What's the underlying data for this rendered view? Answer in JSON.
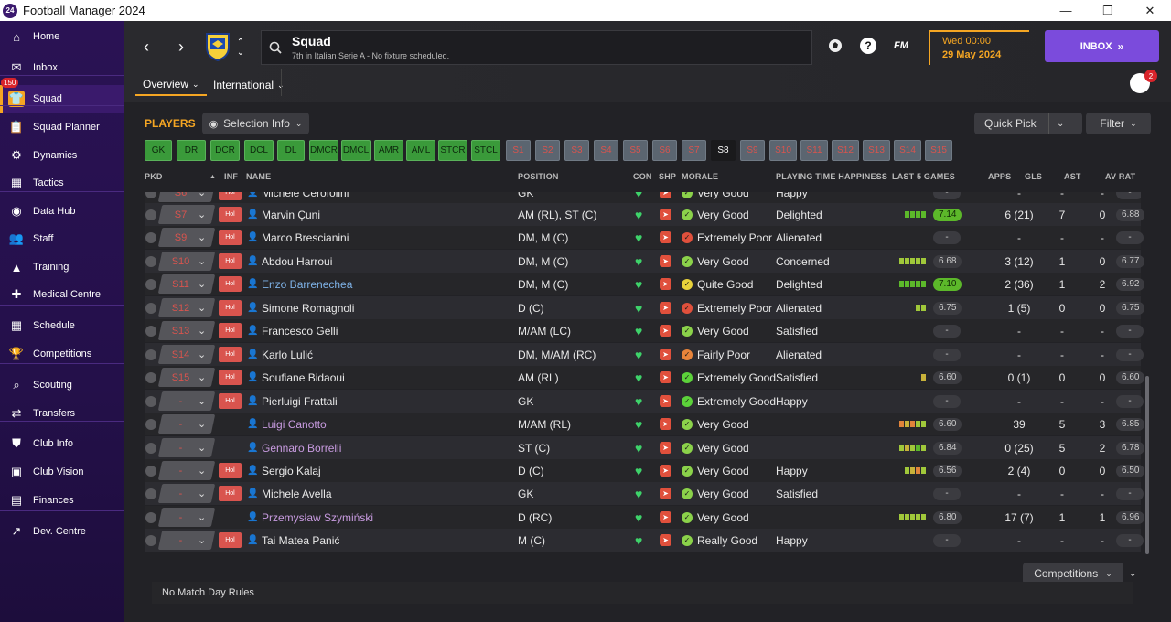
{
  "window": {
    "app_icon": "24",
    "title": "Football Manager 2024",
    "minimize": "—",
    "maximize": "❐",
    "close": "✕"
  },
  "sidebar": {
    "inbox_badge": "150",
    "items": [
      {
        "label": "Home",
        "icon": "home-icon"
      },
      {
        "label": "Inbox",
        "icon": "inbox-icon"
      },
      {
        "label": "Squad",
        "icon": "squad-icon"
      },
      {
        "label": "Squad Planner",
        "icon": "clipboard-icon"
      },
      {
        "label": "Dynamics",
        "icon": "dynamics-icon"
      },
      {
        "label": "Tactics",
        "icon": "tactics-icon"
      },
      {
        "label": "Data Hub",
        "icon": "data-hub-icon"
      },
      {
        "label": "Staff",
        "icon": "staff-icon"
      },
      {
        "label": "Training",
        "icon": "training-icon"
      },
      {
        "label": "Medical Centre",
        "icon": "medical-icon"
      },
      {
        "label": "Schedule",
        "icon": "calendar-icon"
      },
      {
        "label": "Competitions",
        "icon": "trophy-icon"
      },
      {
        "label": "Scouting",
        "icon": "scouting-icon"
      },
      {
        "label": "Transfers",
        "icon": "transfers-icon"
      },
      {
        "label": "Club Info",
        "icon": "shield-icon"
      },
      {
        "label": "Club Vision",
        "icon": "briefcase-icon"
      },
      {
        "label": "Finances",
        "icon": "money-icon"
      },
      {
        "label": "Dev. Centre",
        "icon": "dev-centre-icon"
      }
    ]
  },
  "header": {
    "title": "Squad",
    "subtitle": "7th in Italian Serie A - No fixture scheduled.",
    "fm_label": "FM",
    "help_label": "?",
    "day_time": "Wed 00:00",
    "date": "29 May 2024",
    "inbox_button": "INBOX",
    "notif_count": "2",
    "tabs": [
      {
        "label": "Overview"
      },
      {
        "label": "International"
      }
    ]
  },
  "toolbar": {
    "players_label": "PLAYERS",
    "selection_info": "Selection Info",
    "quick_pick": "Quick Pick",
    "filter": "Filter"
  },
  "position_chips": {
    "green": [
      "GK",
      "DR",
      "DCR",
      "DCL",
      "DL",
      "DMCR",
      "DMCL",
      "AMR",
      "AML",
      "STCR",
      "STCL"
    ],
    "sub": [
      "S1",
      "S2",
      "S3",
      "S4",
      "S5",
      "S6",
      "S7",
      "S8",
      "S9",
      "S10",
      "S11",
      "S12",
      "S13",
      "S14",
      "S15"
    ],
    "selected": "S8"
  },
  "table": {
    "headers": {
      "pkd": "PKD",
      "inf": "INF",
      "name": "NAME",
      "position": "POSITION",
      "con": "CON",
      "shp": "SHP",
      "morale": "MORALE",
      "pth": "PLAYING TIME HAPPINESS",
      "last5": "LAST 5 GAMES",
      "apps": "APPS",
      "gls": "GLS",
      "ast": "AST",
      "avrat": "AV RAT"
    },
    "rows": [
      {
        "pkd": "S6",
        "inf": "Hol",
        "name": "Michele Cerofolini",
        "style": "normal",
        "pos": "GK",
        "morale": "Very Good",
        "mcolor": "#8bd24a",
        "pth": "Happy",
        "form": [],
        "rating": "-",
        "apps": "-",
        "gls": "-",
        "ast": "-",
        "av": "-"
      },
      {
        "pkd": "S7",
        "inf": "Hol",
        "name": "Marvin Çuni",
        "style": "normal",
        "pos": "AM (RL), ST (C)",
        "morale": "Very Good",
        "mcolor": "#8bd24a",
        "pth": "Delighted",
        "form": [
          "#5cb82a",
          "#5cb82a",
          "#5cb82a",
          "#5cb82a"
        ],
        "rating": "7.14",
        "hi": true,
        "apps": "6 (21)",
        "gls": "7",
        "ast": "0",
        "av": "6.88"
      },
      {
        "pkd": "S9",
        "inf": "Hol",
        "name": "Marco Brescianini",
        "style": "normal",
        "pos": "DM, M (C)",
        "morale": "Extremely Poor",
        "mcolor": "#e0503c",
        "pth": "Alienated",
        "form": [],
        "rating": "-",
        "apps": "-",
        "gls": "-",
        "ast": "-",
        "av": "-"
      },
      {
        "pkd": "S10",
        "inf": "Hol",
        "name": "Abdou Harroui",
        "style": "normal",
        "pos": "DM, M (C)",
        "morale": "Very Good",
        "mcolor": "#8bd24a",
        "pth": "Concerned",
        "form": [
          "#a0c83a",
          "#a0c83a",
          "#a0c83a",
          "#a0c83a",
          "#a0c83a"
        ],
        "rating": "6.68",
        "apps": "3 (12)",
        "gls": "1",
        "ast": "0",
        "av": "6.77"
      },
      {
        "pkd": "S11",
        "inf": "Hol",
        "name": "Enzo Barrenechea",
        "style": "link",
        "pos": "DM, M (C)",
        "morale": "Quite Good",
        "mcolor": "#e8d23a",
        "pth": "Delighted",
        "form": [
          "#5cb82a",
          "#5cb82a",
          "#5cb82a",
          "#5cb82a",
          "#5cb82a"
        ],
        "rating": "7.10",
        "hi": true,
        "apps": "2 (36)",
        "gls": "1",
        "ast": "2",
        "av": "6.92"
      },
      {
        "pkd": "S12",
        "inf": "Hol",
        "name": "Simone Romagnoli",
        "style": "normal",
        "pos": "D (C)",
        "morale": "Extremely Poor",
        "mcolor": "#e0503c",
        "pth": "Alienated",
        "form": [
          "#a0c83a",
          "#a0c83a"
        ],
        "rating": "6.75",
        "apps": "1 (5)",
        "gls": "0",
        "ast": "0",
        "av": "6.75"
      },
      {
        "pkd": "S13",
        "inf": "Hol",
        "name": "Francesco Gelli",
        "style": "normal",
        "pos": "M/AM (LC)",
        "morale": "Very Good",
        "mcolor": "#8bd24a",
        "pth": "Satisfied",
        "form": [],
        "rating": "-",
        "apps": "-",
        "gls": "-",
        "ast": "-",
        "av": "-"
      },
      {
        "pkd": "S14",
        "inf": "Hol",
        "name": "Karlo Lulić",
        "style": "normal",
        "pos": "DM, M/AM (RC)",
        "morale": "Fairly Poor",
        "mcolor": "#e8843a",
        "pth": "Alienated",
        "form": [],
        "rating": "-",
        "apps": "-",
        "gls": "-",
        "ast": "-",
        "av": "-"
      },
      {
        "pkd": "S15",
        "inf": "Hol",
        "name": "Soufiane Bidaoui",
        "style": "normal",
        "pos": "AM (RL)",
        "morale": "Extremely Good",
        "mcolor": "#5cd23a",
        "pth": "Satisfied",
        "form": [
          "#c8b23a"
        ],
        "rating": "6.60",
        "apps": "0 (1)",
        "gls": "0",
        "ast": "0",
        "av": "6.60"
      },
      {
        "pkd": "-",
        "inf": "Hol",
        "name": "Pierluigi Frattali",
        "style": "normal",
        "pos": "GK",
        "morale": "Extremely Good",
        "mcolor": "#5cd23a",
        "pth": "Happy",
        "form": [],
        "rating": "-",
        "apps": "-",
        "gls": "-",
        "ast": "-",
        "av": "-"
      },
      {
        "pkd": "-",
        "inf": "",
        "name": "Luigi Canotto",
        "style": "loan",
        "pos": "M/AM (RL)",
        "morale": "Very Good",
        "mcolor": "#8bd24a",
        "pth": "",
        "form": [
          "#e0843a",
          "#c8b23a",
          "#e0843a",
          "#a0c83a",
          "#a0c83a"
        ],
        "rating": "6.60",
        "apps": "39",
        "gls": "5",
        "ast": "3",
        "av": "6.85"
      },
      {
        "pkd": "-",
        "inf": "",
        "name": "Gennaro Borrelli",
        "style": "loan",
        "pos": "ST (C)",
        "morale": "Very Good",
        "mcolor": "#8bd24a",
        "pth": "",
        "form": [
          "#a0c83a",
          "#c8b23a",
          "#a0c83a",
          "#5cb82a",
          "#a0c83a"
        ],
        "rating": "6.84",
        "apps": "0 (25)",
        "gls": "5",
        "ast": "2",
        "av": "6.78"
      },
      {
        "pkd": "-",
        "inf": "Hol",
        "name": "Sergio Kalaj",
        "style": "normal",
        "pos": "D (C)",
        "morale": "Very Good",
        "mcolor": "#8bd24a",
        "pth": "Happy",
        "form": [
          "#a0c83a",
          "#c8b23a",
          "#e0843a",
          "#a0c83a"
        ],
        "rating": "6.56",
        "apps": "2 (4)",
        "gls": "0",
        "ast": "0",
        "av": "6.50"
      },
      {
        "pkd": "-",
        "inf": "Hol",
        "name": "Michele Avella",
        "style": "normal",
        "pos": "GK",
        "morale": "Very Good",
        "mcolor": "#8bd24a",
        "pth": "Satisfied",
        "form": [],
        "rating": "-",
        "apps": "-",
        "gls": "-",
        "ast": "-",
        "av": "-"
      },
      {
        "pkd": "-",
        "inf": "",
        "name": "Przemysław Szymiński",
        "style": "loan",
        "pos": "D (RC)",
        "morale": "Very Good",
        "mcolor": "#8bd24a",
        "pth": "",
        "form": [
          "#a0c83a",
          "#a0c83a",
          "#a0c83a",
          "#a0c83a",
          "#a0c83a"
        ],
        "rating": "6.80",
        "apps": "17 (7)",
        "gls": "1",
        "ast": "1",
        "av": "6.96"
      },
      {
        "pkd": "-",
        "inf": "Hol",
        "name": "Tai Matea Panić",
        "style": "normal",
        "pos": "M (C)",
        "morale": "Really Good",
        "mcolor": "#8bd24a",
        "pth": "Happy",
        "form": [],
        "rating": "-",
        "apps": "-",
        "gls": "-",
        "ast": "-",
        "av": "-"
      }
    ]
  },
  "footer": {
    "competitions": "Competitions",
    "rules": "No Match Day Rules"
  }
}
